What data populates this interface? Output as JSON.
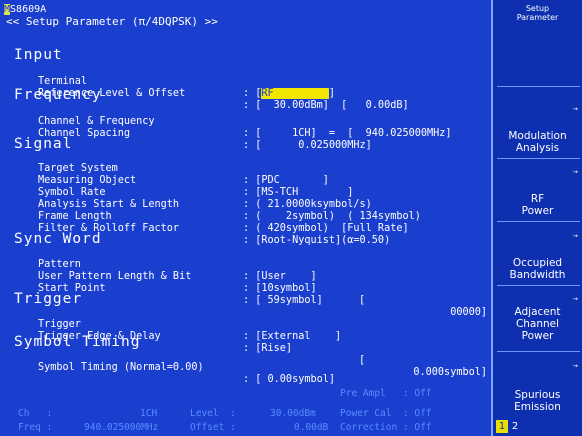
{
  "header": {
    "model_first_char": "M",
    "model_rest": "S8609A",
    "title": "<< Setup Parameter (π/4DQPSK) >>"
  },
  "sections": {
    "input": "Input",
    "frequency": "Frequency",
    "signal": "Signal",
    "sync_word": "Sync Word",
    "trigger": "Trigger",
    "symbol_timing": "Symbol Timing"
  },
  "params": {
    "terminal": {
      "label": "Terminal",
      "sep": ": [",
      "value": "RF",
      "close": "]"
    },
    "ref_level": {
      "label": "Reference Level & Offset",
      "value": ": [  30.00dBm]  [   0.00dB]"
    },
    "channel_freq": {
      "label": "Channel & Frequency",
      "value": ": [     1CH]  =  [  940.025000MHz]"
    },
    "channel_spacing": {
      "label": "Channel Spacing",
      "value": ": [      0.025000MHz]"
    },
    "target_system": {
      "label": "Target System",
      "value": ": [PDC       ]"
    },
    "measuring_object": {
      "label": "Measuring Object",
      "value": ": [MS-TCH        ]"
    },
    "symbol_rate": {
      "label": "Symbol Rate",
      "value": ": ( 21.0000ksymbol/s)"
    },
    "analysis_start": {
      "label": "Analysis Start & Length",
      "value": ": (    2symbol)  ( 134symbol)"
    },
    "frame_length": {
      "label": "Frame Length",
      "value": ": ( 420symbol)  [Full Rate]"
    },
    "filter": {
      "label": "Filter & Rolloff Factor",
      "value": ": [Root-Nyquist](α=0.50)"
    },
    "pattern": {
      "label": "Pattern",
      "value": ": [User    ]"
    },
    "user_pattern": {
      "label": "User Pattern Length & Bit",
      "value": ": [10symbol]",
      "bracket": "[",
      "bits": "00000]"
    },
    "start_point": {
      "label": "Start Point",
      "value": ": [ 59symbol]"
    },
    "trigger": {
      "label": "Trigger",
      "value": ": [External    ]"
    },
    "trigger_edge": {
      "label": "Trigger Edge & Delay",
      "value": ": [Rise]",
      "bracket": "[",
      "delay": "0.000symbol]"
    },
    "symbol_timing": {
      "label": "Symbol Timing (Normal=0.00)",
      "value": ": [ 0.00symbol]"
    }
  },
  "status": {
    "pre_ampl": "Pre Ampl   : Off",
    "ch": "Ch   :",
    "ch_val": "1CH",
    "level": "Level  :",
    "level_val": "30.00dBm",
    "power_cal": "Power Cal  : Off",
    "freq": "Freq :",
    "freq_val": "940.025000MHz",
    "offset": "Offset :",
    "offset_val": "0.00dB",
    "correction": "Correction : Off"
  },
  "softkeys": {
    "title_line1": "Setup",
    "title_line2": "Parameter",
    "arrow": "→",
    "items": [
      {
        "line1": "Modulation",
        "line2": "Analysis"
      },
      {
        "line1": "RF",
        "line2": "Power"
      },
      {
        "line1": "Occupied",
        "line2": "Bandwidth"
      },
      {
        "line1": "Adjacent",
        "line2": "Channel",
        "line3": "Power"
      },
      {
        "line1": "Spurious",
        "line2": "Emission"
      }
    ],
    "page1": "1",
    "page2": "2"
  }
}
